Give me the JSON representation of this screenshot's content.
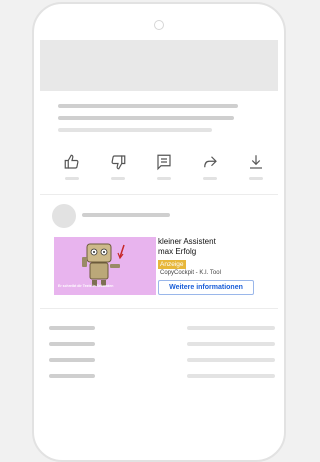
{
  "ad": {
    "title_line1": "kleiner Assistent",
    "title_line2": "max Erfolg",
    "badge": "Anzeige",
    "source": "CopyCockpit - K.I. Tool",
    "cta": "Weitere informationen",
    "image_caption": "Er schreibt dir Texts in Sekunden",
    "image_bg": "#e8b4ee"
  },
  "actions": [
    {
      "icon": "thumbs-up-icon"
    },
    {
      "icon": "thumbs-down-icon"
    },
    {
      "icon": "comment-icon"
    },
    {
      "icon": "share-icon"
    },
    {
      "icon": "download-icon"
    }
  ],
  "colors": {
    "accent": "#1a5ed8",
    "badge": "#e7b73a",
    "placeholder": "#e2e2e2"
  }
}
